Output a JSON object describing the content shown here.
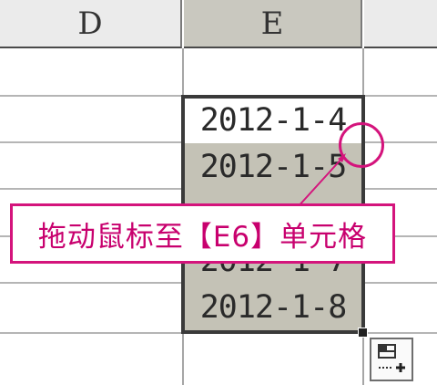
{
  "columns": {
    "d": "D",
    "e": "E"
  },
  "cells": {
    "e4": "2012-1-4",
    "e5": "2012-1-5",
    "e7": "2012-1-7",
    "e8": "2012-1-8"
  },
  "callout": {
    "text": "拖动鼠标至【E6】单元格"
  },
  "icons": {
    "autofill": "auto-fill-options-icon"
  },
  "colors": {
    "accent": "#d4147c",
    "selection": "#c4c2b6"
  }
}
